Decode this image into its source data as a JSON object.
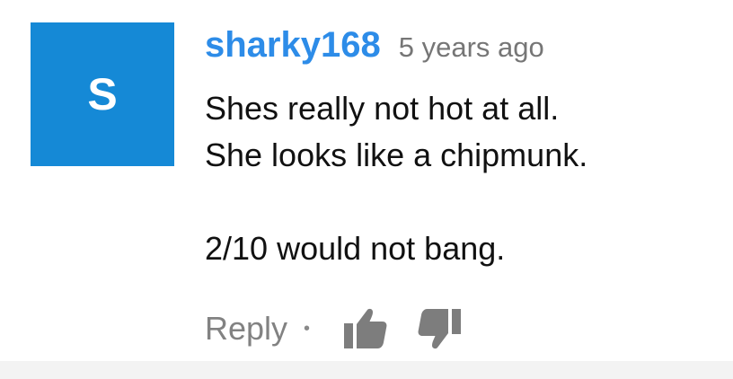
{
  "comment": {
    "avatar_letter": "S",
    "avatar_color": "#1589d6",
    "username": "sharky168",
    "username_color": "#2d8ce8",
    "timestamp": "5 years ago",
    "body_lines": [
      "Shes really not hot at all.",
      "She looks like a chipmunk.",
      "2/10 would not bang."
    ],
    "actions": {
      "reply_label": "Reply",
      "separator": "•",
      "like_icon": "thumbs-up-icon",
      "dislike_icon": "thumbs-down-icon"
    }
  }
}
